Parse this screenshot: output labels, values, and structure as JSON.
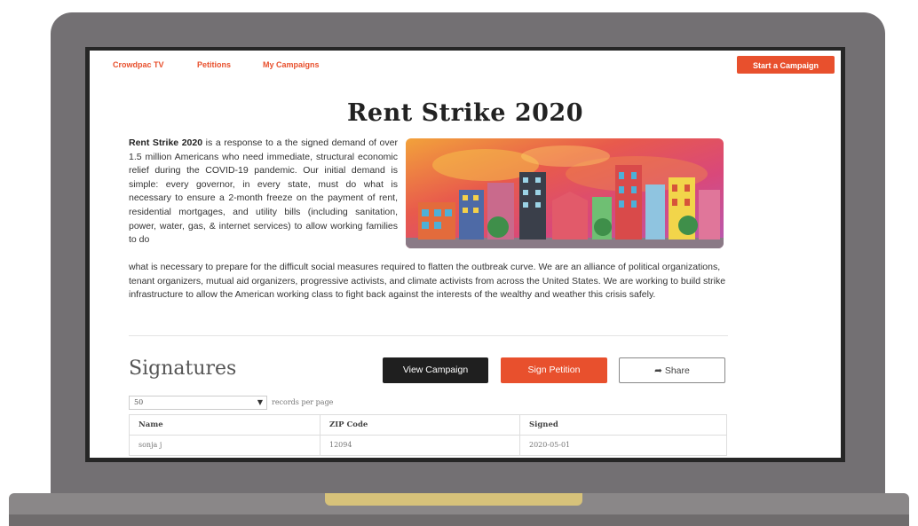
{
  "nav": {
    "links": [
      "Crowdpac TV",
      "Petitions",
      "My Campaigns"
    ],
    "cta_label": "Start a Campaign"
  },
  "campaign": {
    "title": "Rent Strike 2020",
    "intro_bold": "Rent Strike 2020",
    "intro_rest": " is a response to a the signed demand of over 1.5 million Americans who need immediate, structural economic relief during the COVID-19 pandemic. Our initial demand is simple: every governor, in every state, must do what is necessary to ensure a 2-month freeze on the payment of rent, residential mortgages, and utility bills (including sanitation, power, water, gas, & internet services) to allow working families to do",
    "body_continued": "what is necessary to prepare for the difficult social measures required to flatten the outbreak curve. We are an alliance of political organizations, tenant organizers, mutual aid organizers, progressive activists, and climate activists from across the United States. We are working to build strike infrastructure to allow the American working class to fight back against the interests of the wealthy and weather this crisis safely."
  },
  "signatures": {
    "heading": "Signatures",
    "view_campaign_label": "View Campaign",
    "sign_petition_label": "Sign Petition",
    "share_label": "Share",
    "records_per_page_value": "50",
    "records_per_page_label": "records per page",
    "table": {
      "headers": [
        "Name",
        "ZIP Code",
        "Signed"
      ],
      "rows": [
        {
          "name": "sonja j",
          "zip": "12094",
          "signed": "2020-05-01"
        }
      ]
    }
  },
  "colors": {
    "accent": "#e8502d",
    "dark_button": "#1f1f1f",
    "laptop_body": "#737073",
    "hinge": "#d7c27a"
  },
  "icons": {
    "share": "share-arrow-icon",
    "select_chevron": "chevron-down-icon"
  }
}
